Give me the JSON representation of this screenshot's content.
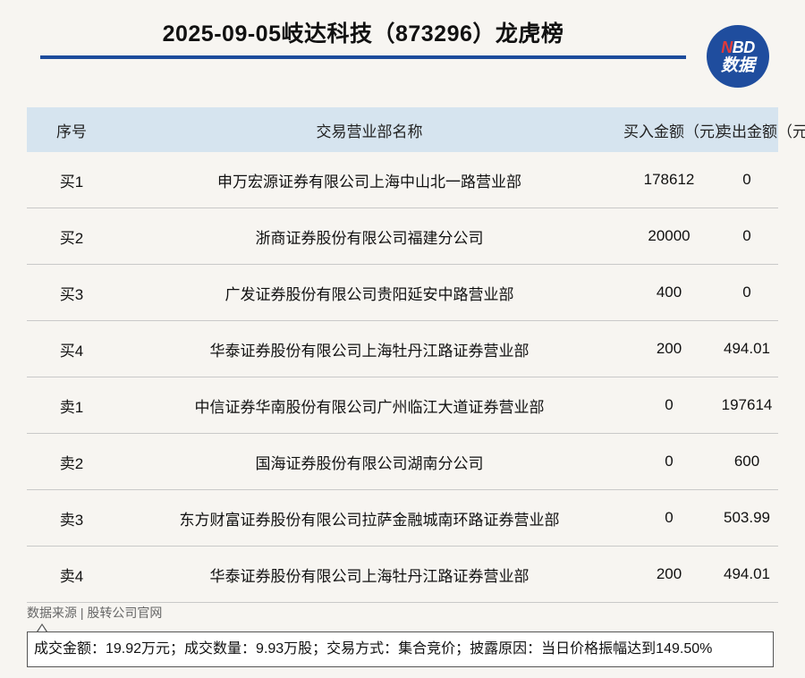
{
  "header": {
    "title": "2025-09-05岐达科技（873296）龙虎榜",
    "logo_line1_n": "N",
    "logo_line1_rest": "BD",
    "logo_line2": "数据"
  },
  "table": {
    "columns": [
      "序号",
      "交易营业部名称",
      "买入金额（元）",
      "卖出金额（元）"
    ],
    "rows": [
      {
        "seq": "买1",
        "name": "申万宏源证券有限公司上海中山北一路营业部",
        "buy": "178612",
        "sell": "0"
      },
      {
        "seq": "买2",
        "name": "浙商证券股份有限公司福建分公司",
        "buy": "20000",
        "sell": "0"
      },
      {
        "seq": "买3",
        "name": "广发证券股份有限公司贵阳延安中路营业部",
        "buy": "400",
        "sell": "0"
      },
      {
        "seq": "买4",
        "name": "华泰证券股份有限公司上海牡丹江路证券营业部",
        "buy": "200",
        "sell": "494.01"
      },
      {
        "seq": "卖1",
        "name": "中信证券华南股份有限公司广州临江大道证券营业部",
        "buy": "0",
        "sell": "197614"
      },
      {
        "seq": "卖2",
        "name": "国海证券股份有限公司湖南分公司",
        "buy": "0",
        "sell": "600"
      },
      {
        "seq": "卖3",
        "name": "东方财富证券股份有限公司拉萨金融城南环路证券营业部",
        "buy": "0",
        "sell": "503.99"
      },
      {
        "seq": "卖4",
        "name": "华泰证券股份有限公司上海牡丹江路证券营业部",
        "buy": "200",
        "sell": "494.01"
      }
    ]
  },
  "footer": {
    "source": "数据来源 | 股转公司官网",
    "summary": "成交金额：19.92万元；成交数量：9.93万股；交易方式：集合竞价；披露原因：当日价格振幅达到149.50%"
  },
  "colors": {
    "accent": "#1d4c9c",
    "header_bg": "#d6e4ef",
    "logo_red": "#e23a3a"
  }
}
